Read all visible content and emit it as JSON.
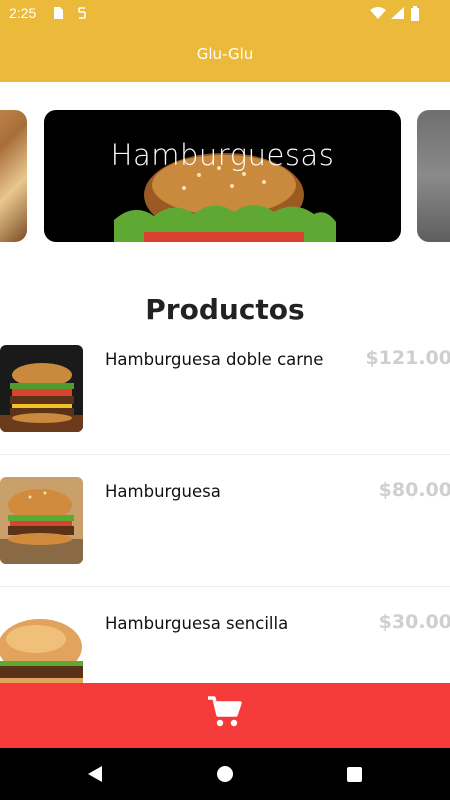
{
  "status_bar": {
    "time": "2:25"
  },
  "app_bar": {
    "title": "Glu-Glu"
  },
  "categories": [
    {
      "label": ""
    },
    {
      "label": "Hamburguesas"
    },
    {
      "label": ""
    }
  ],
  "section_title": "Productos",
  "products": [
    {
      "name": "Hamburguesa doble carne",
      "price": "$121.00"
    },
    {
      "name": "Hamburguesa",
      "price": "$80.00"
    },
    {
      "name": "Hamburguesa sencilla",
      "price": "$30.00"
    }
  ],
  "cart": {
    "icon": "cart-icon"
  },
  "nav": {
    "icons": [
      "back-icon",
      "home-icon",
      "recents-icon"
    ]
  },
  "colors": {
    "primary": "#ecba3b",
    "cart": "#f53a3a",
    "price": "#cfcfcf"
  }
}
